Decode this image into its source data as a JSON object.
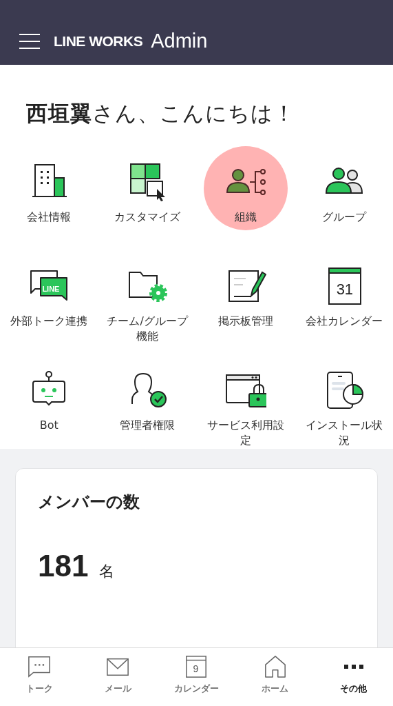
{
  "header": {
    "logo": "LINE WORKS",
    "title": "Admin"
  },
  "greeting": "**西垣翼**さん、こんにちは！",
  "menu": [
    {
      "label": "会社情報",
      "selected": false
    },
    {
      "label": "カスタマイズ",
      "selected": false
    },
    {
      "label": "組織",
      "selected": true
    },
    {
      "label": "グループ",
      "selected": false
    },
    {
      "label": "外部トーク連携",
      "selected": false,
      "icon_text": "LINE"
    },
    {
      "label": "チーム/グループ機能",
      "selected": false
    },
    {
      "label": "掲示板管理",
      "selected": false
    },
    {
      "label": "会社カレンダー",
      "selected": false,
      "icon_text": "31"
    },
    {
      "label": "Bot",
      "selected": false
    },
    {
      "label": "管理者権限",
      "selected": false
    },
    {
      "label": "サービス利用設定",
      "selected": false
    },
    {
      "label": "インストール状況",
      "selected": false
    }
  ],
  "member_card": {
    "title": "メンバーの数",
    "count": "181",
    "unit": "名"
  },
  "bottom_nav": [
    {
      "label": "トーク",
      "selected": false
    },
    {
      "label": "メール",
      "selected": false
    },
    {
      "label": "カレンダー",
      "selected": false,
      "icon_text": "9"
    },
    {
      "label": "ホーム",
      "selected": false
    },
    {
      "label": "その他",
      "selected": true
    }
  ]
}
